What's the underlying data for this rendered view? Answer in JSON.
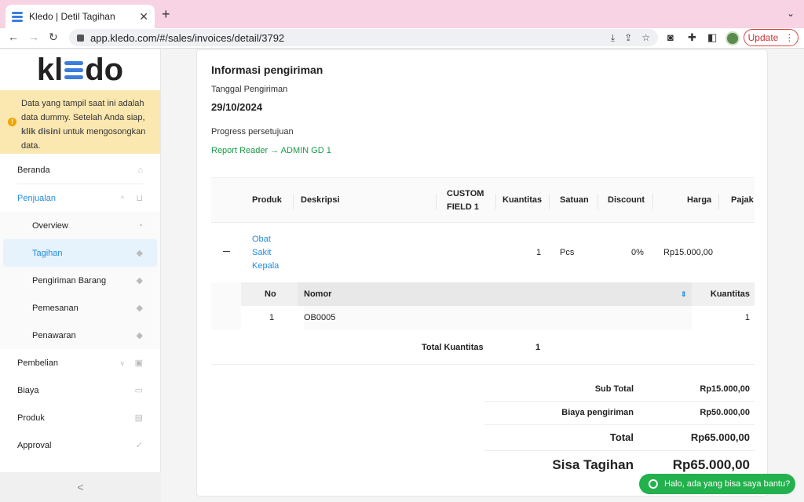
{
  "browser": {
    "tab_title": "Kledo | Detil Tagihan",
    "tab_close": "✕",
    "new_tab": "+",
    "url": "app.kledo.com/#/sales/invoices/detail/3792",
    "update_label": "Update",
    "update_menu": "⋮"
  },
  "sidebar": {
    "logo_left": "kl",
    "logo_right": "do",
    "notice_text_1": "Data yang tampil saat ini adalah data dummy. Setelah Anda siap, ",
    "notice_link": "klik disini",
    "notice_text_2": " untuk mengosongkan data.",
    "items": [
      {
        "label": "Beranda"
      },
      {
        "label": "Penjualan"
      },
      {
        "label": "Overview"
      },
      {
        "label": "Tagihan"
      },
      {
        "label": "Pengiriman Barang"
      },
      {
        "label": "Pemesanan"
      },
      {
        "label": "Penawaran"
      },
      {
        "label": "Pembelian"
      },
      {
        "label": "Biaya"
      },
      {
        "label": "Produk"
      },
      {
        "label": "Approval"
      }
    ],
    "collapse_label": "<"
  },
  "shipping": {
    "title": "Informasi pengiriman",
    "date_label": "Tanggal Pengiriman",
    "date_value": "29/10/2024",
    "progress_label": "Progress persetujuan",
    "approval_from": "Report Reader",
    "approval_arrow": "→",
    "approval_to": "ADMIN GD 1"
  },
  "table": {
    "headers": {
      "produk": "Produk",
      "deskripsi": "Deskripsi",
      "custom_1": "CUSTOM",
      "custom_2": "FIELD 1",
      "kuantitas": "Kuantitas",
      "satuan": "Satuan",
      "discount": "Discount",
      "harga": "Harga",
      "pajak": "Pajak"
    },
    "row": {
      "produk_1": "Obat",
      "produk_2": "Sakit",
      "produk_3": "Kepala",
      "kuantitas": "1",
      "satuan": "Pcs",
      "discount": "0%",
      "harga": "Rp15.000,00"
    },
    "serial": {
      "headers": {
        "no": "No",
        "nomor": "Nomor",
        "kuantitas": "Kuantitas"
      },
      "rows": [
        {
          "no": "1",
          "nomor": "OB0005",
          "kuantitas": "1"
        }
      ]
    },
    "total_label": "Total Kuantitas",
    "total_value": "1"
  },
  "summary": {
    "subtotal_label": "Sub Total",
    "subtotal_value": "Rp15.000,00",
    "shipping_label": "Biaya pengiriman",
    "shipping_value": "Rp50.000,00",
    "total_label": "Total",
    "total_value": "Rp65.000,00",
    "remaining_label": "Sisa Tagihan",
    "remaining_value": "Rp65.000,00"
  },
  "chat": {
    "label": "Halo, ada yang bisa saya bantu?"
  }
}
